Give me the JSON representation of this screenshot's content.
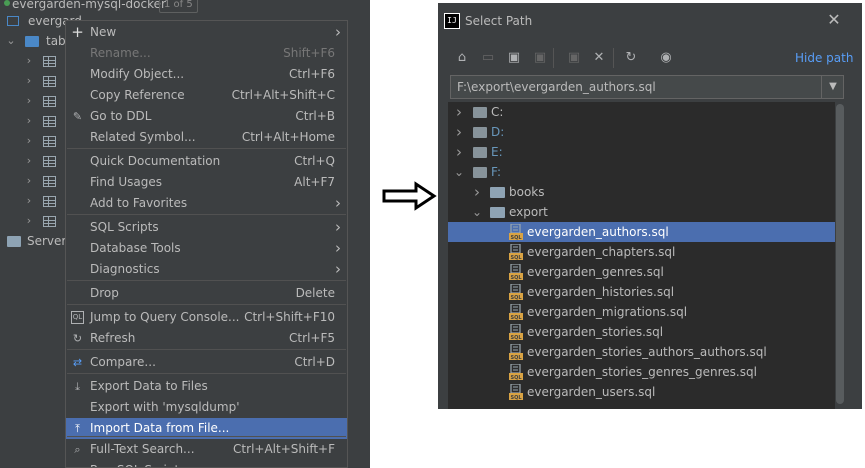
{
  "ide": {
    "project_title": "evergarden-mysql-docker",
    "project_badge": "1 of 5",
    "root_node": "evergard",
    "tables_node": "tabl",
    "server_node": "Server C"
  },
  "context_menu": {
    "items": [
      {
        "label": "New",
        "shortcut": "",
        "submenu": true,
        "disabled": false,
        "icon": "plus-icon"
      },
      {
        "label": "Rename...",
        "shortcut": "Shift+F6",
        "submenu": false,
        "disabled": true
      },
      {
        "label": "Modify Object...",
        "shortcut": "Ctrl+F6",
        "submenu": false,
        "disabled": false
      },
      {
        "label": "Copy Reference",
        "shortcut": "Ctrl+Alt+Shift+C",
        "submenu": false,
        "disabled": false
      },
      {
        "label": "Go to DDL",
        "shortcut": "Ctrl+B",
        "submenu": false,
        "disabled": false,
        "icon": "pencil-icon"
      },
      {
        "label": "Related Symbol...",
        "shortcut": "Ctrl+Alt+Home",
        "submenu": false,
        "disabled": false
      },
      {
        "label": "Quick Documentation",
        "shortcut": "Ctrl+Q",
        "submenu": false,
        "disabled": false
      },
      {
        "label": "Find Usages",
        "shortcut": "Alt+F7",
        "submenu": false,
        "disabled": false
      },
      {
        "label": "Add to Favorites",
        "shortcut": "",
        "submenu": true,
        "disabled": false
      },
      {
        "label": "SQL Scripts",
        "shortcut": "",
        "submenu": true,
        "disabled": false
      },
      {
        "label": "Database Tools",
        "shortcut": "",
        "submenu": true,
        "disabled": false
      },
      {
        "label": "Diagnostics",
        "shortcut": "",
        "submenu": true,
        "disabled": false
      },
      {
        "label": "Drop",
        "shortcut": "Delete",
        "submenu": false,
        "disabled": false
      },
      {
        "label": "Jump to Query Console...",
        "shortcut": "Ctrl+Shift+F10",
        "submenu": false,
        "disabled": false,
        "icon": "query-console-icon"
      },
      {
        "label": "Refresh",
        "shortcut": "Ctrl+F5",
        "submenu": false,
        "disabled": false,
        "icon": "refresh-icon"
      },
      {
        "label": "Compare...",
        "shortcut": "Ctrl+D",
        "submenu": false,
        "disabled": false,
        "icon": "compare-icon"
      },
      {
        "label": "Export Data to Files",
        "shortcut": "",
        "submenu": false,
        "disabled": false,
        "icon": "export-icon"
      },
      {
        "label": "Export with 'mysqldump'",
        "shortcut": "",
        "submenu": false,
        "disabled": false
      },
      {
        "label": "Import Data from File...",
        "shortcut": "",
        "submenu": false,
        "disabled": false,
        "selected": true,
        "icon": "import-icon"
      },
      {
        "label": "Full-Text Search...",
        "shortcut": "Ctrl+Alt+Shift+F",
        "submenu": false,
        "disabled": false,
        "icon": "search-icon"
      },
      {
        "label": "Run SQL Script...",
        "shortcut": "",
        "submenu": false,
        "disabled": false
      }
    ]
  },
  "dialog": {
    "title": "Select Path",
    "hide_path": "Hide path",
    "path_value": "F:\\export\\evergarden_authors.sql",
    "drives": [
      "C:",
      "D:",
      "E:",
      "F:"
    ],
    "folders": [
      "books",
      "export"
    ],
    "files": [
      "evergarden_authors.sql",
      "evergarden_chapters.sql",
      "evergarden_genres.sql",
      "evergarden_histories.sql",
      "evergarden_migrations.sql",
      "evergarden_stories.sql",
      "evergarden_stories_authors_authors.sql",
      "evergarden_stories_genres_genres.sql",
      "evergarden_users.sql"
    ]
  },
  "colors": {
    "panel": "#3c3f41",
    "tree_bg": "#2b2b2b",
    "selection": "#4b6eaf",
    "link": "#589df6",
    "text": "#bbbbbb",
    "disabled": "#777777"
  }
}
